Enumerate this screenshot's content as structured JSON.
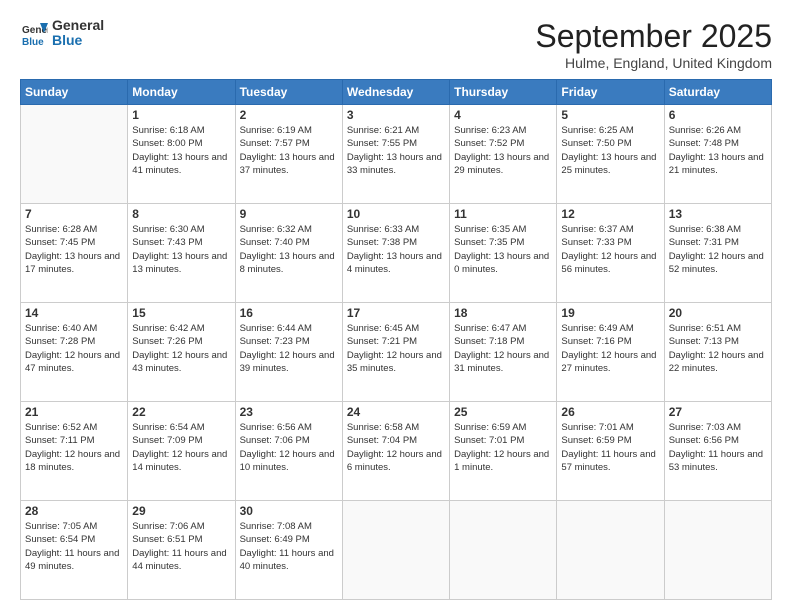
{
  "logo": {
    "general": "General",
    "blue": "Blue"
  },
  "title": "September 2025",
  "subtitle": "Hulme, England, United Kingdom",
  "days_of_week": [
    "Sunday",
    "Monday",
    "Tuesday",
    "Wednesday",
    "Thursday",
    "Friday",
    "Saturday"
  ],
  "weeks": [
    [
      {
        "day": "",
        "info": ""
      },
      {
        "day": "1",
        "info": "Sunrise: 6:18 AM\nSunset: 8:00 PM\nDaylight: 13 hours\nand 41 minutes."
      },
      {
        "day": "2",
        "info": "Sunrise: 6:19 AM\nSunset: 7:57 PM\nDaylight: 13 hours\nand 37 minutes."
      },
      {
        "day": "3",
        "info": "Sunrise: 6:21 AM\nSunset: 7:55 PM\nDaylight: 13 hours\nand 33 minutes."
      },
      {
        "day": "4",
        "info": "Sunrise: 6:23 AM\nSunset: 7:52 PM\nDaylight: 13 hours\nand 29 minutes."
      },
      {
        "day": "5",
        "info": "Sunrise: 6:25 AM\nSunset: 7:50 PM\nDaylight: 13 hours\nand 25 minutes."
      },
      {
        "day": "6",
        "info": "Sunrise: 6:26 AM\nSunset: 7:48 PM\nDaylight: 13 hours\nand 21 minutes."
      }
    ],
    [
      {
        "day": "7",
        "info": "Sunrise: 6:28 AM\nSunset: 7:45 PM\nDaylight: 13 hours\nand 17 minutes."
      },
      {
        "day": "8",
        "info": "Sunrise: 6:30 AM\nSunset: 7:43 PM\nDaylight: 13 hours\nand 13 minutes."
      },
      {
        "day": "9",
        "info": "Sunrise: 6:32 AM\nSunset: 7:40 PM\nDaylight: 13 hours\nand 8 minutes."
      },
      {
        "day": "10",
        "info": "Sunrise: 6:33 AM\nSunset: 7:38 PM\nDaylight: 13 hours\nand 4 minutes."
      },
      {
        "day": "11",
        "info": "Sunrise: 6:35 AM\nSunset: 7:35 PM\nDaylight: 13 hours\nand 0 minutes."
      },
      {
        "day": "12",
        "info": "Sunrise: 6:37 AM\nSunset: 7:33 PM\nDaylight: 12 hours\nand 56 minutes."
      },
      {
        "day": "13",
        "info": "Sunrise: 6:38 AM\nSunset: 7:31 PM\nDaylight: 12 hours\nand 52 minutes."
      }
    ],
    [
      {
        "day": "14",
        "info": "Sunrise: 6:40 AM\nSunset: 7:28 PM\nDaylight: 12 hours\nand 47 minutes."
      },
      {
        "day": "15",
        "info": "Sunrise: 6:42 AM\nSunset: 7:26 PM\nDaylight: 12 hours\nand 43 minutes."
      },
      {
        "day": "16",
        "info": "Sunrise: 6:44 AM\nSunset: 7:23 PM\nDaylight: 12 hours\nand 39 minutes."
      },
      {
        "day": "17",
        "info": "Sunrise: 6:45 AM\nSunset: 7:21 PM\nDaylight: 12 hours\nand 35 minutes."
      },
      {
        "day": "18",
        "info": "Sunrise: 6:47 AM\nSunset: 7:18 PM\nDaylight: 12 hours\nand 31 minutes."
      },
      {
        "day": "19",
        "info": "Sunrise: 6:49 AM\nSunset: 7:16 PM\nDaylight: 12 hours\nand 27 minutes."
      },
      {
        "day": "20",
        "info": "Sunrise: 6:51 AM\nSunset: 7:13 PM\nDaylight: 12 hours\nand 22 minutes."
      }
    ],
    [
      {
        "day": "21",
        "info": "Sunrise: 6:52 AM\nSunset: 7:11 PM\nDaylight: 12 hours\nand 18 minutes."
      },
      {
        "day": "22",
        "info": "Sunrise: 6:54 AM\nSunset: 7:09 PM\nDaylight: 12 hours\nand 14 minutes."
      },
      {
        "day": "23",
        "info": "Sunrise: 6:56 AM\nSunset: 7:06 PM\nDaylight: 12 hours\nand 10 minutes."
      },
      {
        "day": "24",
        "info": "Sunrise: 6:58 AM\nSunset: 7:04 PM\nDaylight: 12 hours\nand 6 minutes."
      },
      {
        "day": "25",
        "info": "Sunrise: 6:59 AM\nSunset: 7:01 PM\nDaylight: 12 hours\nand 1 minute."
      },
      {
        "day": "26",
        "info": "Sunrise: 7:01 AM\nSunset: 6:59 PM\nDaylight: 11 hours\nand 57 minutes."
      },
      {
        "day": "27",
        "info": "Sunrise: 7:03 AM\nSunset: 6:56 PM\nDaylight: 11 hours\nand 53 minutes."
      }
    ],
    [
      {
        "day": "28",
        "info": "Sunrise: 7:05 AM\nSunset: 6:54 PM\nDaylight: 11 hours\nand 49 minutes."
      },
      {
        "day": "29",
        "info": "Sunrise: 7:06 AM\nSunset: 6:51 PM\nDaylight: 11 hours\nand 44 minutes."
      },
      {
        "day": "30",
        "info": "Sunrise: 7:08 AM\nSunset: 6:49 PM\nDaylight: 11 hours\nand 40 minutes."
      },
      {
        "day": "",
        "info": ""
      },
      {
        "day": "",
        "info": ""
      },
      {
        "day": "",
        "info": ""
      },
      {
        "day": "",
        "info": ""
      }
    ]
  ]
}
